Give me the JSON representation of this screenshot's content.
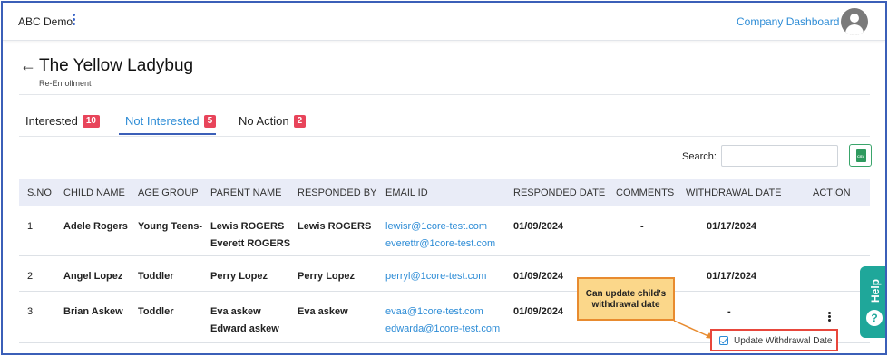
{
  "header": {
    "app_name": "ABC Demo",
    "company_link": "Company Dashboard"
  },
  "page": {
    "title": "The Yellow Ladybug",
    "subtitle": "Re-Enrollment"
  },
  "tabs": [
    {
      "label": "Interested",
      "count": "10"
    },
    {
      "label": "Not Interested",
      "count": "5"
    },
    {
      "label": "No Action",
      "count": "2"
    }
  ],
  "search": {
    "label": "Search:",
    "value": ""
  },
  "table": {
    "headers": [
      "S.NO",
      "CHILD NAME",
      "AGE GROUP",
      "PARENT NAME",
      "RESPONDED BY",
      "EMAIL ID",
      "RESPONDED DATE",
      "COMMENTS",
      "WITHDRAWAL DATE",
      "ACTION"
    ],
    "rows": [
      {
        "sno": "1",
        "child": "Adele Rogers",
        "age_group": "Young Teens-",
        "parent1": "Lewis ROGERS",
        "parent2": "Everett ROGERS",
        "responded_by": "Lewis ROGERS",
        "email1": "lewisr@1core-test.com",
        "email2": "everettr@1core-test.com",
        "responded_date": "01/09/2024",
        "comments": "-",
        "withdrawal_date": "01/17/2024"
      },
      {
        "sno": "2",
        "child": "Angel Lopez",
        "age_group": "Toddler",
        "parent1": "Perry Lopez",
        "parent2": "",
        "responded_by": "Perry Lopez",
        "email1": "perryl@1core-test.com",
        "email2": "",
        "responded_date": "01/09/2024",
        "comments": "",
        "withdrawal_date": "01/17/2024"
      },
      {
        "sno": "3",
        "child": "Brian Askew",
        "age_group": "Toddler",
        "parent1": "Eva askew",
        "parent2": "Edward askew",
        "responded_by": "Eva askew",
        "email1": "evaa@1core-test.com",
        "email2": "edwarda@1core-test.com",
        "responded_date": "01/09/2024",
        "comments": "",
        "withdrawal_date": "-"
      }
    ]
  },
  "action_menu": {
    "update_label": "Update Withdrawal Date"
  },
  "callout": {
    "line1": "Can update child's",
    "line2": "withdrawal date"
  },
  "help": {
    "label": "Help",
    "icon_glyph": "?"
  },
  "colors": {
    "accent": "#2d8cd6",
    "badge": "#e8445a",
    "frame": "#3b5fb8",
    "help": "#1fa79a"
  }
}
